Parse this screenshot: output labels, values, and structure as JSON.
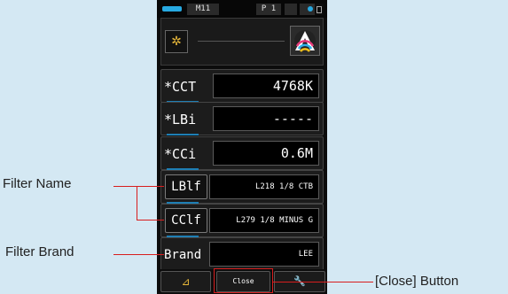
{
  "status": {
    "memory": "M11",
    "page": "P 1"
  },
  "header": {
    "mode_icon": "sun-icon",
    "logo": "a-logo-icon"
  },
  "rows": [
    {
      "label": "*CCT",
      "value": "4768K"
    },
    {
      "label": "*LBi",
      "value": "-----"
    },
    {
      "label": "*CCi",
      "value": "0.6M"
    },
    {
      "label": "LBlf",
      "value": "L218 1/8 CTB"
    },
    {
      "label": "CClf",
      "value": "L279 1/8 MINUS G"
    },
    {
      "label": "Brand",
      "value": "LEE"
    }
  ],
  "bottom": {
    "left_icon": "triangle-icon",
    "close_label": "Close",
    "right_icon": "wrench-icon"
  },
  "annotations": {
    "filter_name": "Filter Name",
    "filter_brand": "Filter Brand",
    "close_button": "[Close] Button"
  },
  "colors": {
    "accent": "#1e7fb5",
    "annotation_line": "#d81e1e",
    "background": "#d4e8f3"
  }
}
